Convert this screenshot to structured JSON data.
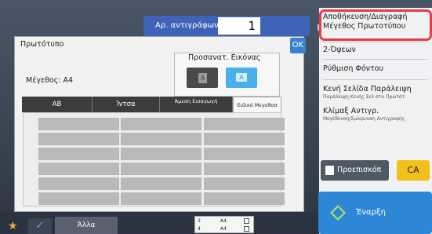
{
  "header": {
    "copies_label": "Αρ. αντιγράφων",
    "copies_value": "1"
  },
  "right_panel": {
    "items": [
      {
        "label": "Αποθήκευση/Διαγραφή Μέγεθος Πρωτοτύπου",
        "sub": ""
      },
      {
        "label": "2-Όψεων",
        "sub": ""
      },
      {
        "label": "Ρύθμιση Φόντου",
        "sub": ""
      },
      {
        "label": "Κενή Σελίδα Παράλειψη",
        "sub": "Παράλειψη Κενής Σελ στο Πρωτότ"
      },
      {
        "label": "Κλίμαξ Αντιγρ.",
        "sub": "Μεγέθυνση/Σμίκρυνση Αντιγραφής"
      }
    ],
    "preview_label": "Προεπισκόπ",
    "ca_label": "CA",
    "start_label": "Έναρξη"
  },
  "dialog": {
    "title": "Πρωτότυπο",
    "ok_label": "OK",
    "size_label": "Μέγεθος: A4",
    "orientation_label": "Προσανατ. Εικόνας",
    "orientation_a_glyph": "A",
    "orientation_b_glyph": "A",
    "tabs": [
      {
        "label": "AB",
        "active": false
      },
      {
        "label": "Ίντσα",
        "active": false
      },
      {
        "label": "Άμεση Εισαγωγή",
        "active": false
      },
      {
        "label": "Ειδικό Μεγεθοσ",
        "active": true
      }
    ]
  },
  "bottom": {
    "other_label": "Άλλα",
    "tray_rows": [
      {
        "num": "3",
        "size": "A4"
      },
      {
        "num": "4",
        "size": "A4"
      }
    ]
  },
  "colors": {
    "highlight": "#e63b48",
    "accent_blue": "#2e87d6",
    "ca_yellow": "#f3c01a"
  }
}
